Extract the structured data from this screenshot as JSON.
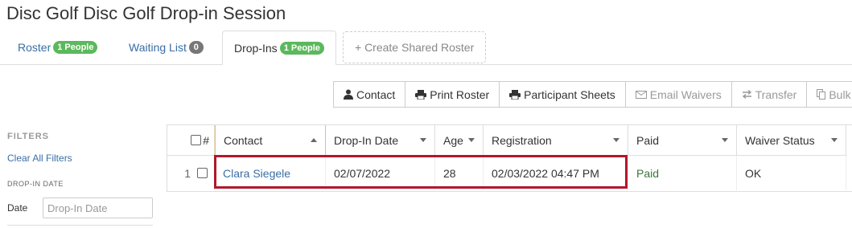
{
  "page": {
    "title": "Disc Golf Disc Golf Drop-in Session"
  },
  "tabs": [
    {
      "label": "Roster",
      "badge": "1 People"
    },
    {
      "label": "Waiting List",
      "badge": "0"
    },
    {
      "label": "Drop-Ins",
      "badge": "1 People"
    },
    {
      "label": "+ Create Shared Roster"
    }
  ],
  "toolbar": {
    "contact": "Contact",
    "print_roster": "Print Roster",
    "participant_sheets": "Participant Sheets",
    "email_waivers": "Email Waivers",
    "transfer": "Transfer",
    "bulk": "Bulk"
  },
  "filters": {
    "heading": "FILTERS",
    "clear": "Clear All Filters",
    "dropin_heading": "DROP-IN DATE",
    "date_label": "Date",
    "date_placeholder": "Drop-In Date",
    "date_value": ""
  },
  "table": {
    "columns": {
      "num": "#",
      "contact": "Contact",
      "dropin_date": "Drop-In Date",
      "age": "Age",
      "registration": "Registration",
      "paid": "Paid",
      "waiver": "Waiver Status"
    },
    "rows": [
      {
        "num": "1",
        "contact": "Clara Siegele",
        "dropin_date": "02/07/2022",
        "age": "28",
        "registration": "02/03/2022 04:47 PM",
        "paid": "Paid",
        "waiver": "OK"
      }
    ]
  },
  "colors": {
    "link": "#3a6ea5",
    "badge": "#5cb85c",
    "highlight": "#b1182c",
    "paid": "#3c763d"
  }
}
